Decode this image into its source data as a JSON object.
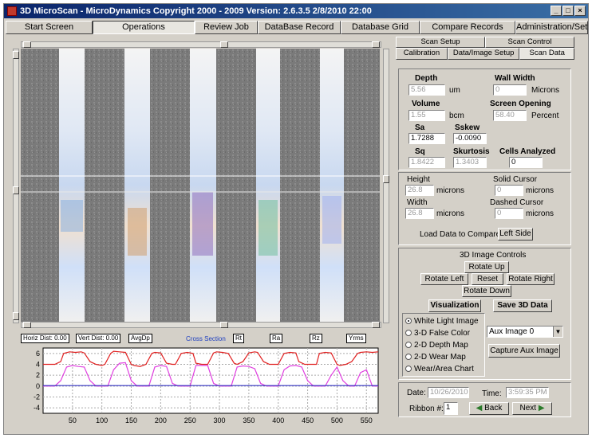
{
  "window": {
    "title": "3D MicroScan - MicroDynamics Copyright 2000 - 2009 Version: 2.6.3.5   2/8/2010 22:00"
  },
  "window_buttons": {
    "minimize": "_",
    "maximize": "□",
    "close": "×"
  },
  "main_tabs": [
    {
      "label": "Start Screen"
    },
    {
      "label": "Operations"
    },
    {
      "label": "Review Job"
    },
    {
      "label": "DataBase Record"
    },
    {
      "label": "Database Grid"
    },
    {
      "label": "Compare Records"
    },
    {
      "label": "Administration/Setup"
    }
  ],
  "sub_tabs_row1": [
    {
      "label": "Scan Setup"
    },
    {
      "label": "Scan Control"
    }
  ],
  "sub_tabs_row2": [
    {
      "label": "Calibration"
    },
    {
      "label": "Data/Image Setup"
    },
    {
      "label": "Scan Data"
    }
  ],
  "plot_buttons": {
    "horiz_dist": "Horiz Dist: 0.00",
    "vert_dist": "Vert Dist: 0.00",
    "avg_dp": "AvgDp",
    "cross_section": "Cross Section",
    "rt": "Rt",
    "ra": "Ra",
    "rz": "Rz",
    "yrms": "Yrms"
  },
  "scan_data": {
    "depth_label": "Depth",
    "depth_value": "5.56",
    "depth_unit": "um",
    "wall_width_label": "Wall Width",
    "wall_width_value": "0",
    "wall_width_unit": "Microns",
    "volume_label": "Volume",
    "volume_value": "1.55",
    "volume_unit": "bcm",
    "screen_opening_label": "Screen Opening",
    "screen_opening_value": "58.40",
    "screen_opening_unit": "Percent",
    "sa_label": "Sa",
    "sa_value": "1.7288",
    "sskew_label": "Sskew",
    "sskew_value": "-0.0090",
    "sq_label": "Sq",
    "sq_value": "1.8422",
    "skurtosis_label": "Skurtosis",
    "skurtosis_value": "1.3403",
    "cells_label": "Cells Analyzed",
    "cells_value": "0"
  },
  "cursor_panel": {
    "height_label": "Height",
    "height_value": "26.8",
    "height_unit": "microns",
    "solid_label": "Solid Cursor",
    "solid_value": "0",
    "solid_unit": "microns",
    "width_label": "Width",
    "width_value": "26.8",
    "width_unit": "microns",
    "dashed_label": "Dashed Cursor",
    "dashed_value": "0",
    "dashed_unit": "microns",
    "load_label": "Load Data  to Compare",
    "left_side_button": "Left Side"
  },
  "image_controls": {
    "title": "3D Image Controls",
    "rotate_up": "Rotate Up",
    "rotate_left": "Rotate Left",
    "reset": "Reset",
    "rotate_right": "Rotate Right",
    "rotate_down": "Rotate Down",
    "visualization": "Visualization",
    "save_3d": "Save 3D Data",
    "options": [
      {
        "label": "White Light Image",
        "selected": true
      },
      {
        "label": "3-D False Color",
        "selected": false
      },
      {
        "label": "2-D Depth Map",
        "selected": false
      },
      {
        "label": "2-D Wear Map",
        "selected": false
      },
      {
        "label": "Wear/Area Chart",
        "selected": false
      }
    ],
    "aux_select": "Aux Image 0",
    "capture_aux": "Capture Aux Image"
  },
  "footer": {
    "date_label": "Date:",
    "date_value": "10/26/2010",
    "time_label": "Time:",
    "time_value": "3:59:35 PM",
    "ribbon_label": "Ribbon #:",
    "ribbon_value": "1",
    "back_button": "Back",
    "next_button": "Next"
  },
  "colors": {
    "series_red": "#e02020",
    "series_magenta": "#e040e0",
    "series_blue": "#3030c0"
  },
  "chart_data": {
    "type": "line",
    "x_ticks": [
      50,
      100,
      150,
      200,
      250,
      300,
      350,
      400,
      450,
      500,
      550
    ],
    "y_ticks": [
      6,
      4,
      2,
      0,
      -2,
      -4
    ],
    "xlim": [
      0,
      570
    ],
    "ylim": [
      -5,
      7
    ],
    "grid": true,
    "series": [
      {
        "color": "red",
        "x": [
          0,
          10,
          20,
          30,
          35,
          45,
          55,
          65,
          70,
          80,
          90,
          100,
          105,
          115,
          120,
          130,
          140,
          150,
          155,
          165,
          175,
          185,
          190,
          200,
          210,
          220,
          225,
          235,
          245,
          255,
          260,
          270,
          280,
          290,
          295,
          305,
          315,
          325,
          330,
          340,
          350,
          360,
          365,
          375,
          385,
          395,
          400,
          410,
          420,
          430,
          435,
          445,
          455,
          465,
          470,
          480,
          490,
          500,
          505,
          515,
          525,
          535,
          540,
          550,
          560,
          570
        ],
        "y": [
          4,
          4,
          4,
          4.5,
          6,
          6.3,
          6.2,
          6.3,
          6.1,
          4.5,
          4,
          3.8,
          4,
          6,
          6.4,
          6.3,
          6.2,
          4,
          3.8,
          3.6,
          4,
          6,
          6.2,
          6.1,
          4.2,
          4,
          4,
          6,
          6.2,
          6,
          4.2,
          4,
          4,
          6.1,
          6.3,
          6.2,
          6,
          4.2,
          4,
          4.5,
          6.1,
          6.3,
          6.2,
          4.5,
          4,
          4,
          4,
          6,
          6.2,
          6.1,
          4.5,
          4,
          4,
          4,
          6,
          6.2,
          6.1,
          4,
          3.8,
          4,
          4.5,
          6,
          6.2,
          6.3,
          6.2,
          6.3
        ]
      },
      {
        "color": "magenta",
        "x": [
          0,
          10,
          20,
          30,
          40,
          50,
          60,
          70,
          80,
          90,
          100,
          110,
          120,
          130,
          140,
          150,
          160,
          170,
          180,
          190,
          200,
          210,
          220,
          230,
          240,
          250,
          260,
          270,
          280,
          290,
          300,
          310,
          320,
          330,
          340,
          350,
          360,
          370,
          380,
          390,
          400,
          410,
          420,
          430,
          440,
          450,
          460,
          470,
          480,
          490,
          500,
          510,
          520,
          530,
          540,
          550,
          560,
          570
        ],
        "y": [
          0,
          0,
          0,
          1,
          3.5,
          3.8,
          3.6,
          3.5,
          1,
          0,
          0,
          0,
          3,
          4.2,
          4.3,
          1,
          0,
          0,
          0,
          3.5,
          3.8,
          3.6,
          0.5,
          0,
          0,
          0,
          3.8,
          3.8,
          3.8,
          0.5,
          0,
          0,
          0,
          3.5,
          3.7,
          3.6,
          3.2,
          0.5,
          0,
          0,
          0,
          3,
          3.7,
          3.8,
          3.5,
          1,
          0,
          0,
          0,
          2,
          3.5,
          1,
          0,
          0,
          2.5,
          3,
          0,
          0
        ]
      },
      {
        "color": "blue",
        "x": [
          0,
          570
        ],
        "y": [
          0.1,
          0.1
        ]
      }
    ]
  }
}
